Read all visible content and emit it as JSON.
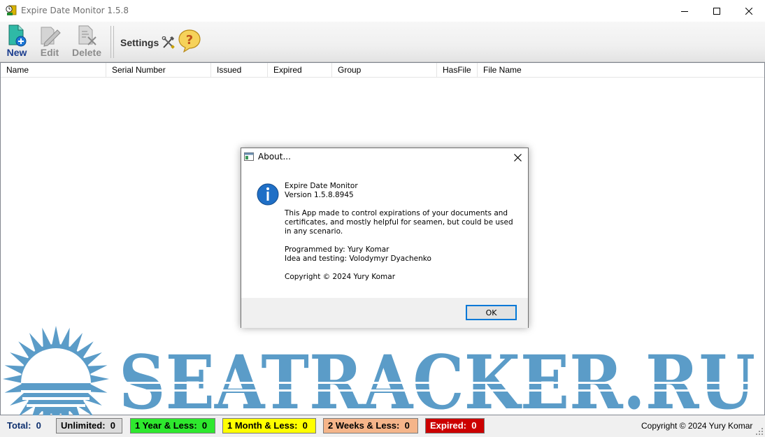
{
  "window": {
    "title": "Expire Date Monitor  1.5.8"
  },
  "toolbar": {
    "new_label": "New",
    "edit_label": "Edit",
    "delete_label": "Delete",
    "settings_label": "Settings"
  },
  "list": {
    "columns": [
      "Name",
      "Serial Number",
      "Issued",
      "Expired",
      "Group",
      "HasFile",
      "File Name"
    ]
  },
  "dialog": {
    "title": "About...",
    "app_name": "Expire Date Monitor",
    "version": "Version 1.5.8.8945",
    "description": "This App made to control expirations of your documents and\ncertificates, and mostly helpful for seamen, but could be used\nin any scenario.",
    "programmed_by": "Programmed by: Yury Komar",
    "idea": "Idea and testing: Volodymyr Dyachenko",
    "copyright": "Copyright © 2024 Yury Komar",
    "ok_label": "OK"
  },
  "watermark": {
    "text": "SEATRACKER.RU",
    "color": "#5b9cc8"
  },
  "status": {
    "total_label": "Total:",
    "total_value": "0",
    "unlimited_label": "Unlimited:",
    "unlimited_value": "0",
    "year_label": "1 Year & Less:",
    "year_value": "0",
    "month_label": "1 Month & Less:",
    "month_value": "0",
    "weeks_label": "2 Weeks & Less:",
    "weeks_value": "0",
    "expired_label": "Expired:",
    "expired_value": "0",
    "copyright": "Copyright © 2024 Yury Komar"
  }
}
